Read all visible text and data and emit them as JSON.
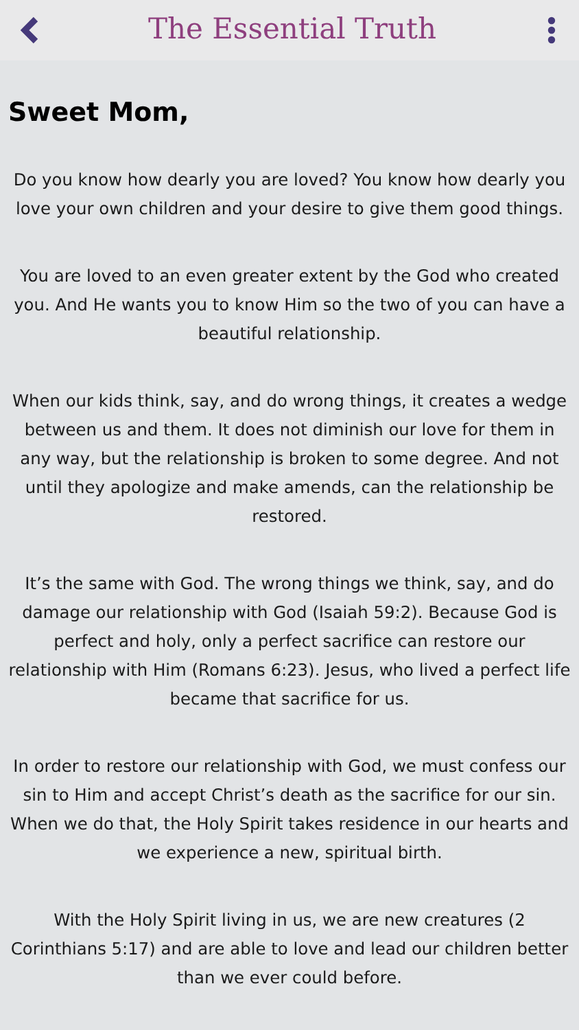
{
  "header": {
    "title": "The Essential Truth"
  },
  "greeting": "Sweet Mom,",
  "paragraphs": [
    "Do you know how dearly you are loved? You know how dearly you love your own children and your desire to give them good things.",
    "You are loved to an even greater extent by the God who created you. And He wants you to know Him so the two of you can have a beautiful relationship.",
    "When our kids think, say, and do wrong things, it creates a wedge between us and them. It does not diminish our love for them in any way, but the relationship is broken to some degree. And not until they apologize and make amends, can the relationship be restored.",
    "It’s the same with God. The wrong things we think, say, and do damage our relationship with God (Isaiah 59:2). Because God is perfect and holy, only a perfect sacrifice can restore our relationship with Him (Romans 6:23). Jesus, who lived a perfect life became that sacrifice for us.",
    "In order to restore our relationship with God, we must confess our sin to Him and accept Christ’s death as the sacrifice for our sin. When we do that, the Holy Spirit takes residence in our hearts and we experience a new, spiritual birth.",
    "With the Holy Spirit living in us, we are new creatures (2 Corinthians 5:17) and are able to love and lead our children better than we ever could before."
  ]
}
